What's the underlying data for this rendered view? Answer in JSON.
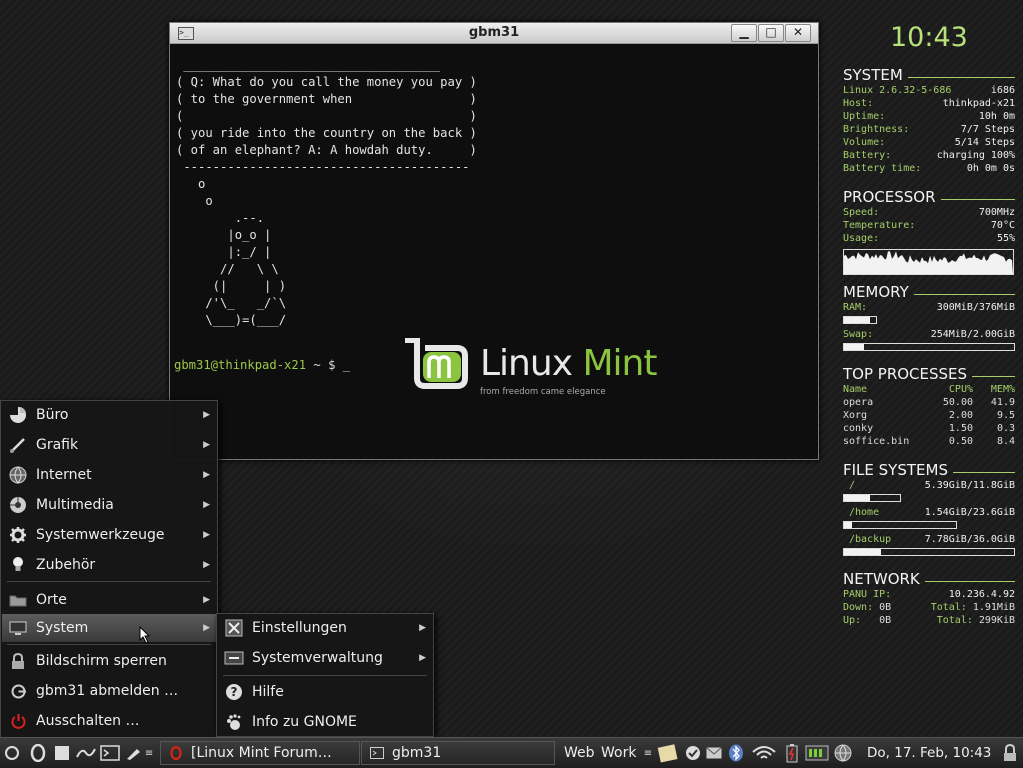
{
  "terminal": {
    "title": "gbm31",
    "controls": {
      "minimize": "▁",
      "maximize": "□",
      "close": "✕"
    },
    "fortune": [
      " ___________________________________",
      "( Q: What do you call the money you pay )",
      "( to the government when                )",
      "(                                       )",
      "( you ride into the country on the back )",
      "( of an elephant? A: A howdah duty.     )",
      " ---------------------------------------",
      "   o",
      "    o",
      "        .--.",
      "       |o_o |",
      "       |:_/ |",
      "      //   \\ \\",
      "     (|     | )",
      "    /'\\_   _/`\\",
      "    \\___)=(___/"
    ],
    "prompt_user": "gbm31@thinkpad-x21",
    "prompt_rest": " ~ $ _"
  },
  "wallpaper": {
    "brand_linux": "Linux",
    "brand_mint": "Mint",
    "tagline": "from freedom came elegance"
  },
  "conky": {
    "clock": "10:43",
    "system": {
      "title": "SYSTEM",
      "rows": [
        {
          "k": "Linux 2.6.32-5-686",
          "v": "i686"
        },
        {
          "k": "Host:",
          "v": "thinkpad-x21"
        },
        {
          "k": "Uptime:",
          "v": "10h 0m"
        },
        {
          "k": "Brightness:",
          "v": "7/7 Steps"
        },
        {
          "k": "Volume:",
          "v": "5/14 Steps"
        },
        {
          "k": "Battery:",
          "v": "charging 100%"
        },
        {
          "k": "Battery time:",
          "v": "0h 0m 0s"
        }
      ]
    },
    "processor": {
      "title": "PROCESSOR",
      "rows": [
        {
          "k": "Speed:",
          "v": "700MHz"
        },
        {
          "k": "Temperature:",
          "v": "70°C"
        },
        {
          "k": "Usage:",
          "v": "55%"
        }
      ]
    },
    "memory": {
      "title": "MEMORY",
      "ram_label": "RAM:",
      "ram_value": "300MiB/376MiB",
      "ram_fraction": 0.8,
      "swap_label": "Swap:",
      "swap_value": "254MiB/2.00GiB",
      "swap_fraction": 0.12
    },
    "top": {
      "title": "TOP PROCESSES",
      "headers": [
        "Name",
        "CPU%",
        "MEM%"
      ],
      "rows": [
        [
          "opera",
          "50.00",
          "41.9"
        ],
        [
          "Xorg",
          "2.00",
          "9.5"
        ],
        [
          "conky",
          "1.50",
          "0.3"
        ],
        [
          "soffice.bin",
          "0.50",
          "8.4"
        ]
      ]
    },
    "filesystems": {
      "title": "FILE SYSTEMS",
      "items": [
        {
          "name": "/",
          "value": "5.39GiB/11.8GiB",
          "fraction": 0.46
        },
        {
          "name": "/home",
          "value": "1.54GiB/23.6GiB",
          "fraction": 0.07
        },
        {
          "name": "/backup",
          "value": "7.78GiB/36.0GiB",
          "fraction": 0.22
        }
      ]
    },
    "network": {
      "title": "NETWORK",
      "ip_label": "PANU IP:",
      "ip_value": "10.236.4.92",
      "down_label": "Down:",
      "down_value": "0B",
      "down_total_label": "Total:",
      "down_total": "1.91MiB",
      "up_label": "Up:",
      "up_value": "0B",
      "up_total_label": "Total:",
      "up_total": "299KiB"
    }
  },
  "menu": {
    "items": [
      {
        "label": "Büro",
        "icon": "office-icon"
      },
      {
        "label": "Grafik",
        "icon": "graphics-icon"
      },
      {
        "label": "Internet",
        "icon": "globe-icon"
      },
      {
        "label": "Multimedia",
        "icon": "multimedia-icon"
      },
      {
        "label": "Systemwerkzeuge",
        "icon": "gear-icon"
      },
      {
        "label": "Zubehör",
        "icon": "lightbulb-icon"
      }
    ],
    "places": "Orte",
    "system": "System",
    "lock": "Bildschirm sperren",
    "logout": "gbm31 abmelden …",
    "shutdown": "Ausschalten …",
    "submenu": {
      "settings": "Einstellungen",
      "admin": "Systemverwaltung",
      "help": "Hilfe",
      "about": "Info zu GNOME"
    }
  },
  "panel": {
    "tasks": [
      {
        "label": "[Linux Mint Forum…",
        "icon": "opera-icon"
      },
      {
        "label": "gbm31",
        "icon": "terminal-icon"
      }
    ],
    "workspaces": [
      "Web",
      "Work"
    ],
    "datetime": "Do, 17. Feb, 10:43"
  }
}
